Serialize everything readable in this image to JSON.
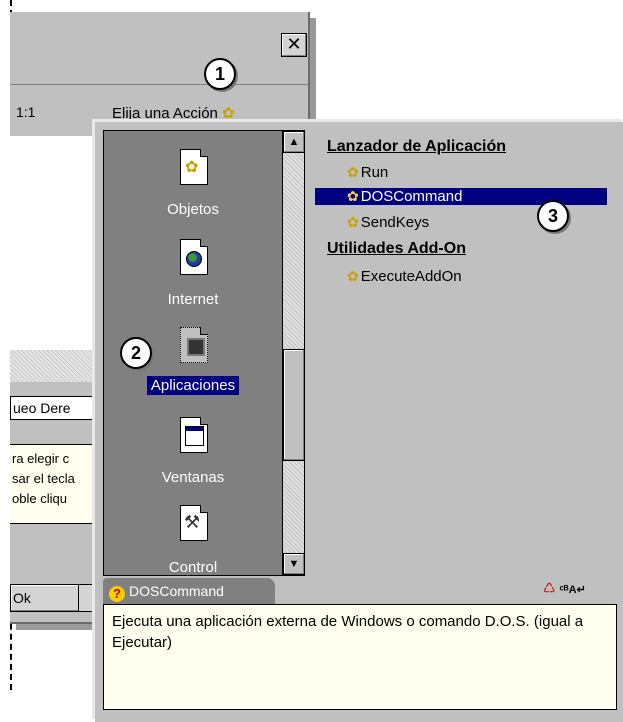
{
  "background_window": {
    "close_label": "✕",
    "ratio_text": "1:1",
    "action_label": "Elija una Acción",
    "field_text": "ueo Dere",
    "hint_lines": [
      "ra elegir c",
      "sar el tecla",
      "oble cliqu"
    ],
    "ok_label": "Ok"
  },
  "icon_list": {
    "items": [
      {
        "label": "Objetos",
        "icon": "gear-doc-icon"
      },
      {
        "label": "Internet",
        "icon": "globe-doc-icon"
      },
      {
        "label": "Aplicaciones",
        "icon": "chip-icon",
        "selected": true
      },
      {
        "label": "Ventanas",
        "icon": "window-icon"
      },
      {
        "label": "Control",
        "icon": "tools-icon"
      }
    ],
    "scroll_up": "▲",
    "scroll_down": "▼"
  },
  "actions": {
    "groups": [
      {
        "title": "Lanzador de  Aplicación",
        "items": [
          "Run",
          "DOSCommand",
          "SendKeys"
        ]
      },
      {
        "title": "Utilidades Add-On",
        "items": [
          "ExecuteAddOn"
        ]
      }
    ],
    "selected": "DOSCommand"
  },
  "description": {
    "tab_icon": "?",
    "tab_label": "DOSCommand",
    "text": "Ejecuta una aplicación externa de Windows o comando D.O.S. (igual a Ejecutar)"
  },
  "callouts": [
    "1",
    "2",
    "3"
  ],
  "colors": {
    "selection": "#000080",
    "panel": "#c0c0c0",
    "dark_panel": "#808080",
    "note": "#fffff0"
  }
}
